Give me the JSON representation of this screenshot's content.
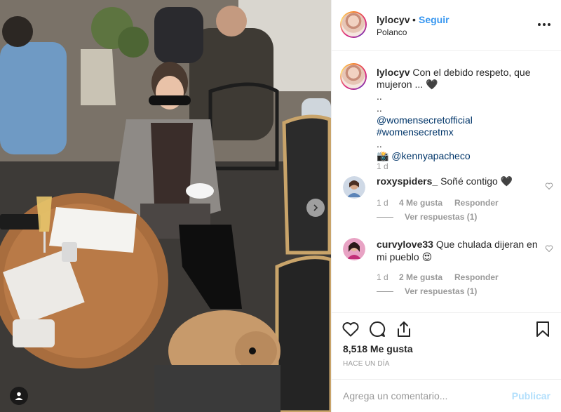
{
  "post": {
    "username": "lylocyv",
    "separator": "•",
    "follow_label": "Seguir",
    "location": "Polanco"
  },
  "caption": {
    "username": "lylocyv",
    "line1": "Con el debido respeto, que mujeron ... 🖤",
    "dot1": "..",
    "dot2": "..",
    "tags": "@womensecretofficial #womensecretmx",
    "dot3": "..",
    "camera_emoji": "📸",
    "credit": "@kennyapacheco",
    "time": "1 d"
  },
  "comments": [
    {
      "username": "roxyspiders_",
      "text": "Soñé contigo 🖤",
      "time": "1 d",
      "likes": "4 Me gusta",
      "reply_label": "Responder",
      "view_replies": "Ver respuestas (1)"
    },
    {
      "username": "curvylove33",
      "text": "Que chulada dijeran en mi pueblo 😍",
      "time": "1 d",
      "likes": "2 Me gusta",
      "reply_label": "Responder",
      "view_replies": "Ver respuestas (1)"
    }
  ],
  "actions": {
    "icons": [
      "heart-icon",
      "comment-icon",
      "share-icon",
      "bookmark-icon"
    ],
    "likes_count": "8,518 Me gusta",
    "posted_ago": "HACE UN DÍA"
  },
  "add_comment": {
    "placeholder": "Agrega un comentario...",
    "publish_label": "Publicar"
  },
  "colors": {
    "link_blue": "#3897f0",
    "publish_disabled": "#b2dffc",
    "text": "#262626",
    "muted": "#999999",
    "border": "#efefef"
  }
}
